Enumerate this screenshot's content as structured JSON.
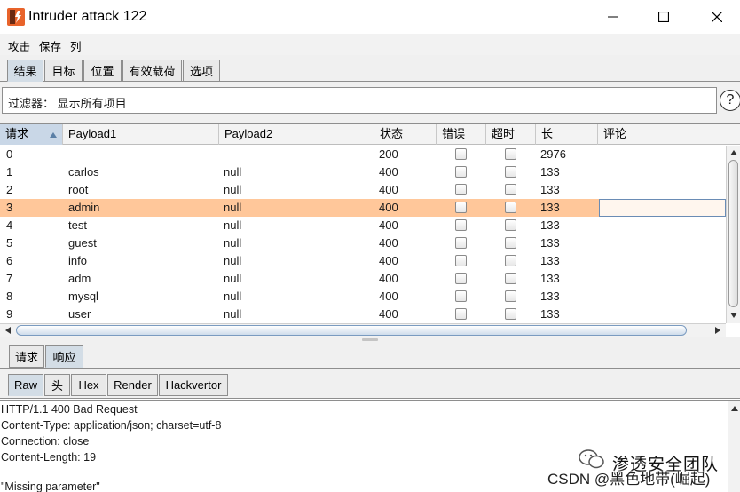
{
  "window": {
    "title": "Intruder attack 122",
    "minimize_icon": "minimize-icon",
    "maximize_icon": "maximize-icon",
    "close_icon": "close-icon",
    "app_icon": "burp-app-icon"
  },
  "menu": [
    "攻击",
    "保存",
    "列"
  ],
  "top_tabs": [
    "结果",
    "目标",
    "位置",
    "有效载荷",
    "选项"
  ],
  "filter": {
    "label": "过滤器：",
    "value": "显示所有项目",
    "help_label": "?"
  },
  "table": {
    "columns": [
      "请求",
      "Payload1",
      "Payload2",
      "状态",
      "错误",
      "超时",
      "长",
      "评论"
    ],
    "sorted_column": "请求",
    "rows": [
      {
        "request": "0",
        "payload1": "",
        "payload2": "",
        "status": "200",
        "error": false,
        "timeout": false,
        "length": "2976",
        "comment": ""
      },
      {
        "request": "1",
        "payload1": "carlos",
        "payload2": "null",
        "status": "400",
        "error": false,
        "timeout": false,
        "length": "133",
        "comment": ""
      },
      {
        "request": "2",
        "payload1": "root",
        "payload2": "null",
        "status": "400",
        "error": false,
        "timeout": false,
        "length": "133",
        "comment": ""
      },
      {
        "request": "3",
        "payload1": "admin",
        "payload2": "null",
        "status": "400",
        "error": false,
        "timeout": false,
        "length": "133",
        "comment": ""
      },
      {
        "request": "4",
        "payload1": "test",
        "payload2": "null",
        "status": "400",
        "error": false,
        "timeout": false,
        "length": "133",
        "comment": ""
      },
      {
        "request": "5",
        "payload1": "guest",
        "payload2": "null",
        "status": "400",
        "error": false,
        "timeout": false,
        "length": "133",
        "comment": ""
      },
      {
        "request": "6",
        "payload1": "info",
        "payload2": "null",
        "status": "400",
        "error": false,
        "timeout": false,
        "length": "133",
        "comment": ""
      },
      {
        "request": "7",
        "payload1": "adm",
        "payload2": "null",
        "status": "400",
        "error": false,
        "timeout": false,
        "length": "133",
        "comment": ""
      },
      {
        "request": "8",
        "payload1": "mysql",
        "payload2": "null",
        "status": "400",
        "error": false,
        "timeout": false,
        "length": "133",
        "comment": ""
      },
      {
        "request": "9",
        "payload1": "user",
        "payload2": "null",
        "status": "400",
        "error": false,
        "timeout": false,
        "length": "133",
        "comment": ""
      }
    ],
    "selected_request": "3"
  },
  "detail_tabs": [
    "请求",
    "响应"
  ],
  "view_tabs": [
    "Raw",
    "头",
    "Hex",
    "Render",
    "Hackvertor"
  ],
  "response_lines": [
    "HTTP/1.1 400 Bad Request",
    "Content-Type: application/json; charset=utf-8",
    "Connection: close",
    "Content-Length: 19",
    "",
    "\"Missing parameter\""
  ],
  "watermark": {
    "line1": "渗透安全团队",
    "line2": "CSDN @黑色地带(崛起)"
  },
  "colors": {
    "selected_row": "#ffc79a",
    "active_tab": "#d3dde6",
    "sorted_header": "#c9d7e7",
    "app_icon_orange": "#e8632a"
  }
}
